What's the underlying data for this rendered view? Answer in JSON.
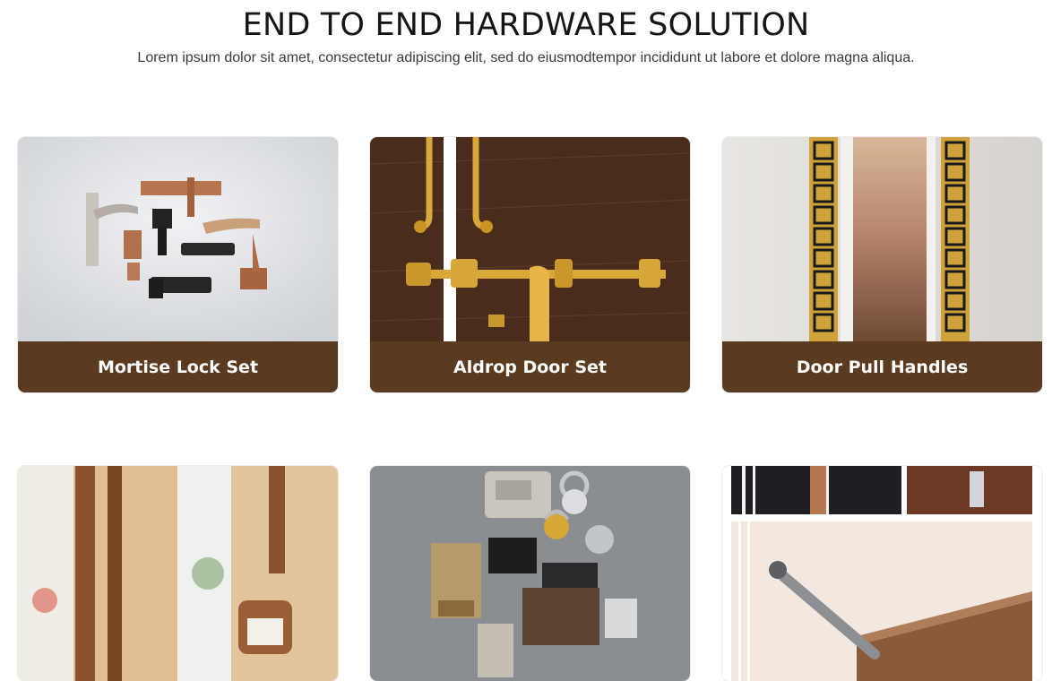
{
  "section": {
    "title": "END TO END HARDWARE SOLUTION",
    "subtitle": "Lorem ipsum dolor sit amet, consectetur adipiscing elit, sed do eiusmodtempor incididunt ut labore et dolore magna aliqua."
  },
  "products": [
    {
      "label": "Mortise Lock Set",
      "image": "mortise-lock-set-photo"
    },
    {
      "label": "Aldrop Door Set",
      "image": "aldrop-door-set-photo"
    },
    {
      "label": "Door Pull Handles",
      "image": "door-pull-handles-photo"
    },
    {
      "label": "",
      "image": "tower-bolts-photo"
    },
    {
      "label": "",
      "image": "locks-and-padlocks-photo"
    },
    {
      "label": "",
      "image": "door-closer-and-hinges-photo"
    }
  ],
  "colors": {
    "caption_bg": "#5a3b1f",
    "caption_text": "#ffffff",
    "title_text": "#151515"
  }
}
